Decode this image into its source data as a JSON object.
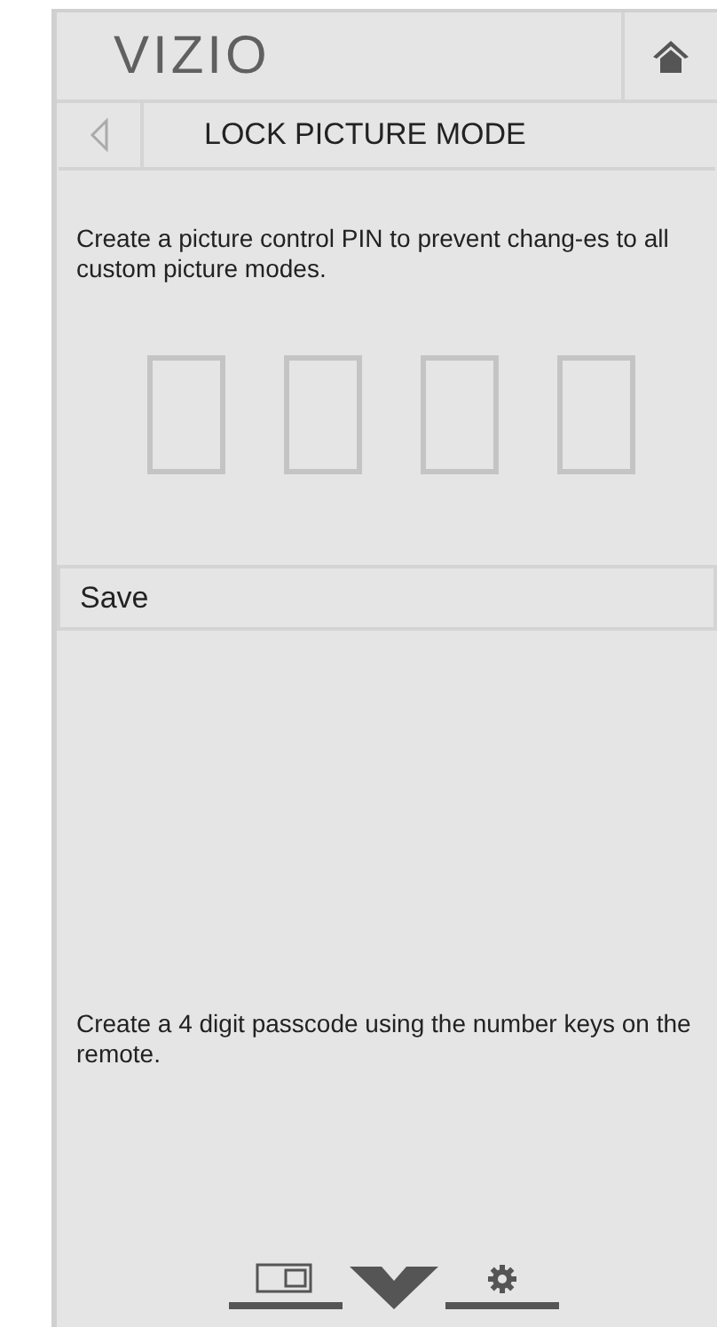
{
  "header": {
    "logo": "VIZIO"
  },
  "title": "LOCK PICTURE MODE",
  "description": "Create a picture control PIN to prevent chang-es to all custom picture modes.",
  "pin_digits": [
    {
      "filled": false
    },
    {
      "filled": false
    },
    {
      "filled": false
    },
    {
      "filled": false
    }
  ],
  "menu_items": [
    {
      "label": "Save",
      "selected": false
    }
  ],
  "hint": "Create a 4 digit passcode using the number keys on the remote."
}
